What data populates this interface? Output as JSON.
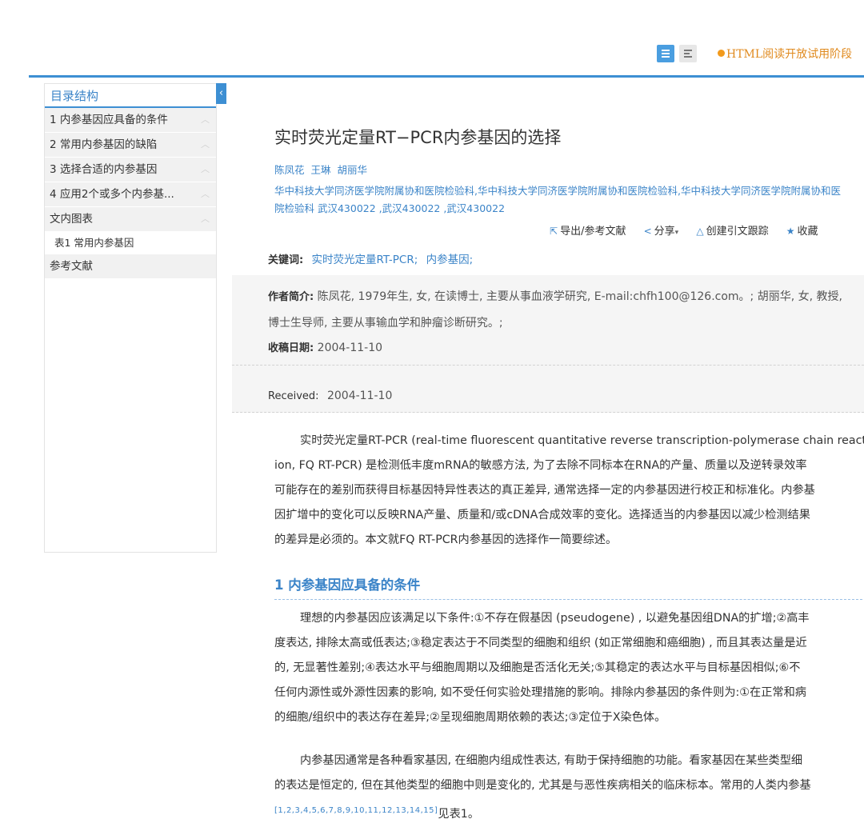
{
  "topbar": {
    "notice": "HTML阅读开放试用阶段"
  },
  "sidebar": {
    "title": "目录结构",
    "items": [
      "1 内参基因应具备的条件",
      "2 常用内参基因的缺陷",
      "3 选择合适的内参基因",
      "4 应用2个或多个内参基...",
      "文内图表"
    ],
    "sub_item": "表1 常用内参基因",
    "refs_item": "参考文献"
  },
  "article": {
    "title": "实时荧光定量RT−PCR内参基因的选择",
    "authors": [
      "陈凤花",
      "王琳",
      "胡丽华"
    ],
    "affiliation": "华中科技大学同济医学院附属协和医院检验科,华中科技大学同济医学院附属协和医院检验科,华中科技大学同济医学院附属协和医院检验科 武汉430022 ,武汉430022 ,武汉430022",
    "affiliation_line1": "华中科技大学同济医学院附属协和医院检验科,华中科技大学同济医学院附属协和医院检验科,华中科技大学同济医学院附属协和医",
    "affiliation_line2": "院检验科 武汉430022 ,武汉430022 ,武汉430022",
    "tools": {
      "export": "导出/参考文献",
      "share": "分享",
      "track": "创建引文跟踪",
      "favorite": "收藏"
    },
    "keywords_label": "关键词:",
    "keywords": [
      "实时荧光定量RT-PCR;",
      "内参基因;"
    ],
    "author_bio_label": "作者简介:",
    "author_bio_line1": "陈凤花, 1979年生, 女, 在读博士, 主要从事血液学研究, E-mail:chfh100@126.com。; 胡丽华, 女, 教授,",
    "author_bio_line2": "博士生导师, 主要从事输血学和肿瘤诊断研究。;",
    "received_cn_label": "收稿日期:",
    "received_cn": "2004-11-10",
    "received_en_label": "Received:",
    "received_en": "2004-11-10",
    "intro_lines": [
      "实时荧光定量RT-PCR (real-time fluorescent quantitative reverse transcription-polymerase chain react",
      "ion, FQ RT-PCR) 是检测低丰度mRNA的敏感方法, 为了去除不同标本在RNA的产量、质量以及逆转录效率",
      "可能存在的差别而获得目标基因特异性表达的真正差异, 通常选择一定的内参基因进行校正和标准化。内参基",
      "因扩增中的变化可以反映RNA产量、质量和/或cDNA合成效率的变化。选择适当的内参基因以减少检测结果",
      "的差异是必须的。本文就FQ RT-PCR内参基因的选择作一简要综述。"
    ],
    "section1_title": "1 内参基因应具备的条件",
    "section1_p1_lines": [
      "理想的内参基因应该满足以下条件:①不存在假基因 (pseudogene) , 以避免基因组DNA的扩增;②高丰",
      "度表达, 排除太高或低表达;③稳定表达于不同类型的细胞和组织 (如正常细胞和癌细胞) , 而且其表达量是近",
      "的, 无显著性差别;④表达水平与细胞周期以及细胞是否活化无关;⑤其稳定的表达水平与目标基因相似;⑥不",
      "任何内源性或外源性因素的影响, 如不受任何实验处理措施的影响。排除内参基因的条件则为:①在正常和病",
      "的细胞/组织中的表达存在差异;②呈现细胞周期依赖的表达;③定位于X染色体。"
    ],
    "section1_p2_lines": [
      "内参基因通常是各种看家基因, 在细胞内组成性表达, 有助于保持细胞的功能。看家基因在某些类型细",
      "的表达是恒定的, 但在其他类型的细胞中则是变化的, 尤其是与恶性疾病相关的临床标本。常用的人类内参基"
    ],
    "refs_sup": "[1,2,3,4,5,6,7,8,9,10,11,12,13,14,15]",
    "refs_tail": "见表1。"
  }
}
